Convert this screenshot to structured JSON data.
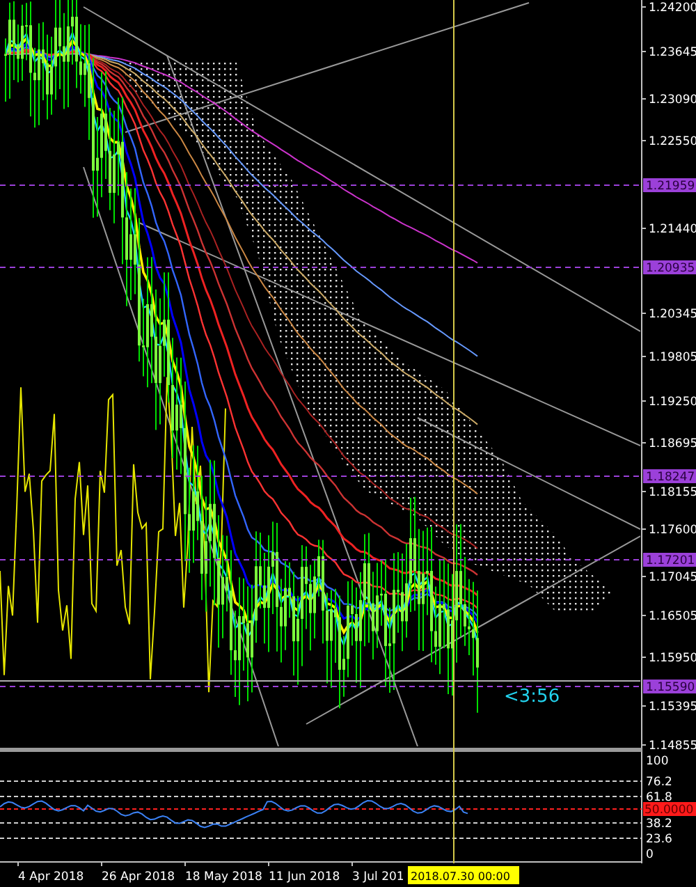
{
  "price_axis": {
    "labels": [
      "1.24200",
      "1.23645",
      "1.23090",
      "1.22550",
      "1.21440",
      "1.20345",
      "1.19805",
      "1.19250",
      "1.18695",
      "1.18155",
      "1.17600",
      "1.17045",
      "1.16505",
      "1.15950",
      "1.15395",
      "1.14855"
    ]
  },
  "price_markers": [
    "1.21959",
    "1.20935",
    "1.18247",
    "1.17201",
    "1.15590"
  ],
  "countdown": "<3:56",
  "indicator_axis": {
    "labels": [
      {
        "text": "100",
        "kind": "plain"
      },
      {
        "text": "76.2",
        "kind": "level"
      },
      {
        "text": "61.8",
        "kind": "level"
      },
      {
        "text": "50.0000",
        "kind": "highlight"
      },
      {
        "text": "38.2",
        "kind": "level"
      },
      {
        "text": "23.6",
        "kind": "level"
      },
      {
        "text": "0",
        "kind": "plain"
      }
    ]
  },
  "time_axis": {
    "labels": [
      "4 Apr 2018",
      "26 Apr 2018",
      "18 May 2018",
      "11 Jun 2018",
      "3 Jul 201"
    ],
    "crosshair_label": "2018.07.30 00:00"
  }
}
